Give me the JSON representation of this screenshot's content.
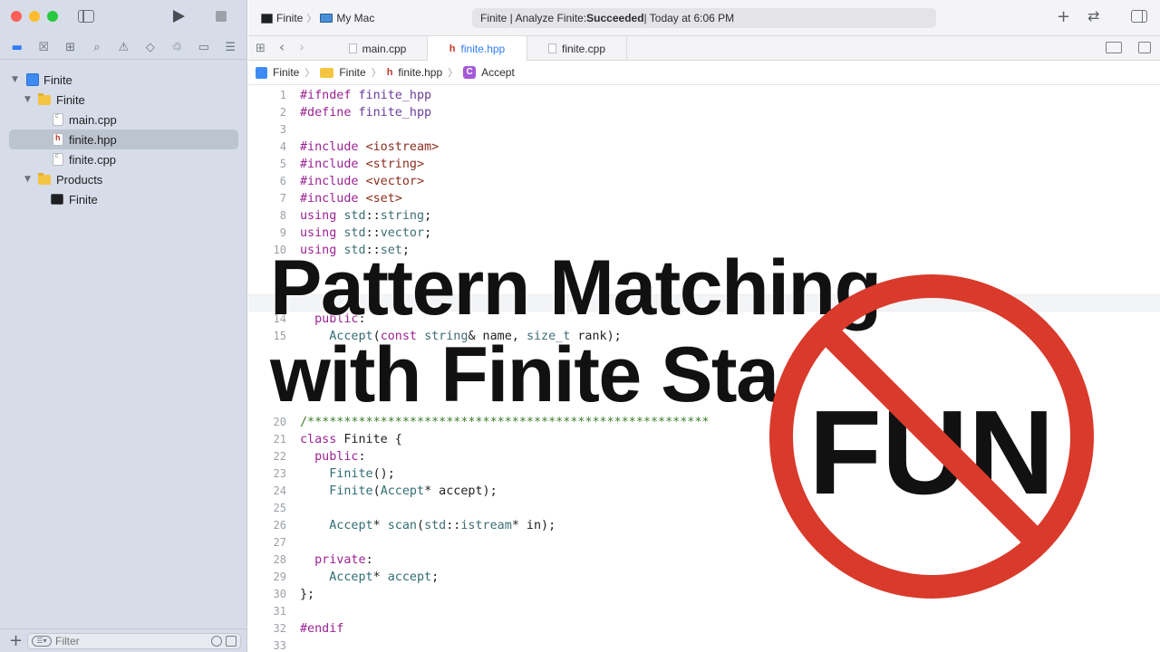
{
  "window": {
    "scheme_target": "Finite",
    "destination": "My Mac",
    "activity": {
      "prefix": "Finite | Analyze Finite: ",
      "status": "Succeeded",
      "suffix": " | Today at 6:06 PM"
    }
  },
  "navigator": {
    "tree": [
      {
        "label": "Finite",
        "kind": "project"
      },
      {
        "label": "Finite",
        "kind": "folder"
      },
      {
        "label": "main.cpp",
        "kind": "cpp"
      },
      {
        "label": "finite.hpp",
        "kind": "header",
        "selected": true
      },
      {
        "label": "finite.cpp",
        "kind": "cpp"
      },
      {
        "label": "Products",
        "kind": "folder"
      },
      {
        "label": "Finite",
        "kind": "executable"
      }
    ],
    "filter_placeholder": "Filter"
  },
  "tabs": [
    {
      "label": "main.cpp",
      "active": false
    },
    {
      "label": "finite.hpp",
      "active": true
    },
    {
      "label": "finite.cpp",
      "active": false
    }
  ],
  "jumpbar": {
    "project": "Finite",
    "folder": "Finite",
    "file": "finite.hpp",
    "symbol_badge": "C",
    "symbol": "Accept"
  },
  "editor": {
    "lines": [
      {
        "n": "1",
        "text": "#ifndef finite_hpp"
      },
      {
        "n": "2",
        "text": "#define finite_hpp"
      },
      {
        "n": "3",
        "text": ""
      },
      {
        "n": "4",
        "text": "#include <iostream>"
      },
      {
        "n": "5",
        "text": "#include <string>"
      },
      {
        "n": "6",
        "text": "#include <vector>"
      },
      {
        "n": "7",
        "text": "#include <set>"
      },
      {
        "n": "8",
        "text": "using std::string;"
      },
      {
        "n": "9",
        "text": "using std::vector;"
      },
      {
        "n": "10",
        "text": "using std::set;"
      },
      {
        "n": "14",
        "text": "  public:"
      },
      {
        "n": "15",
        "text": "    Accept(const string& name, size_t rank);"
      },
      {
        "n": "20",
        "text": "/*******************************************************"
      },
      {
        "n": "21",
        "text": "class Finite {"
      },
      {
        "n": "22",
        "text": "  public:"
      },
      {
        "n": "23",
        "text": "    Finite();"
      },
      {
        "n": "24",
        "text": "    Finite(Accept* accept);"
      },
      {
        "n": "25",
        "text": ""
      },
      {
        "n": "26",
        "text": "    Accept* scan(std::istream* in);"
      },
      {
        "n": "27",
        "text": ""
      },
      {
        "n": "28",
        "text": "  private:"
      },
      {
        "n": "29",
        "text": "    Accept* accept;"
      },
      {
        "n": "30",
        "text": "};"
      },
      {
        "n": "31",
        "text": ""
      },
      {
        "n": "32",
        "text": "#endif"
      },
      {
        "n": "33",
        "text": ""
      }
    ]
  },
  "overlay": {
    "title_line1": "Pattern Matching",
    "title_line2": "with Finite Sta",
    "badge_text": "FUN",
    "badge_color": "#d93a2b"
  }
}
